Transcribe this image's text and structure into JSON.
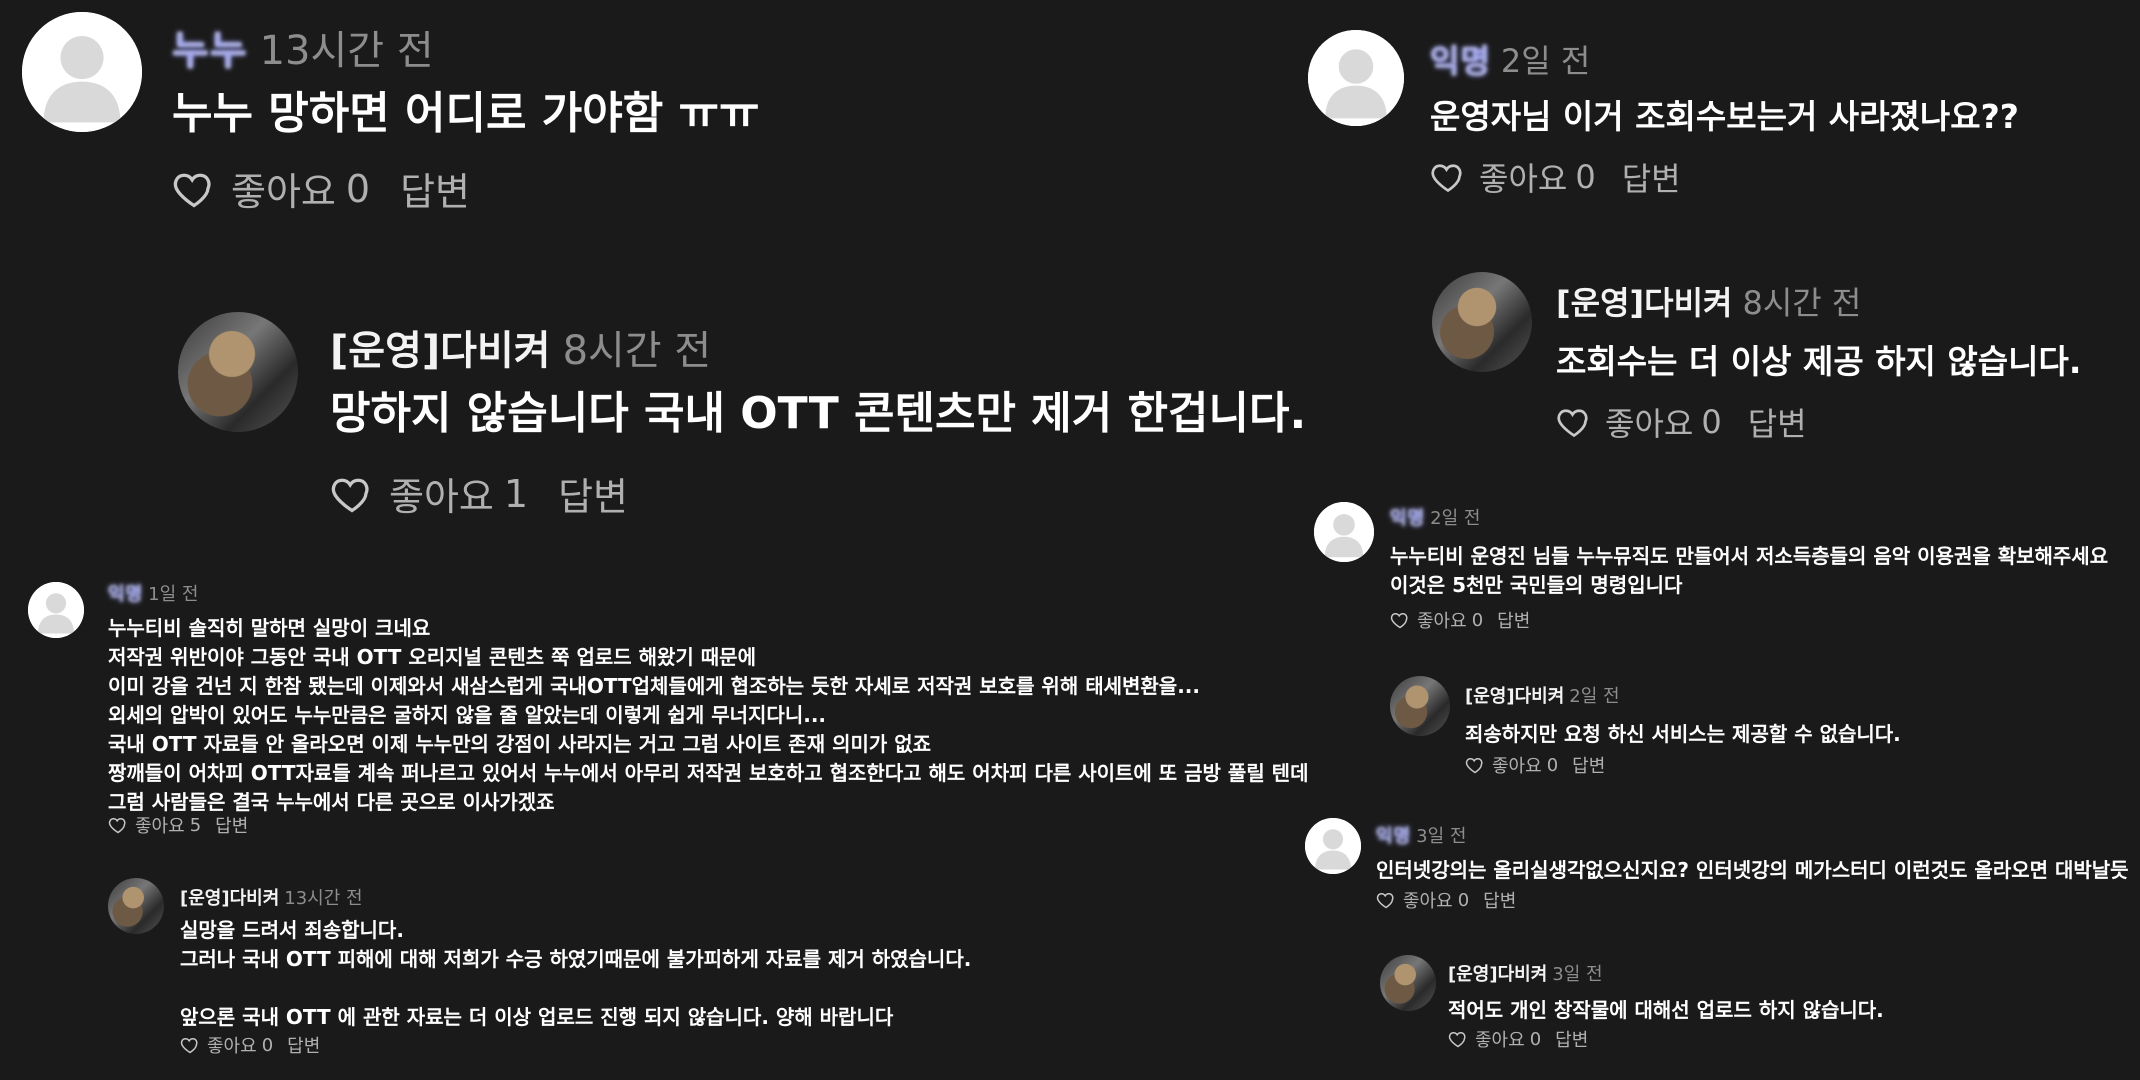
{
  "colors": {
    "background": "#1a1a1a",
    "text": "#ffffff",
    "muted": "#8d8d8d",
    "action": "#b0b0b0"
  },
  "comments": [
    {
      "author": "누누",
      "time": "13시간 전",
      "text": [
        "누누 망하면 어디로 가야함 ㅠㅠ"
      ],
      "like_label": "좋아요",
      "like_count": "0",
      "reply_label": "답변"
    },
    {
      "author": "[운영]다비켜",
      "time": "8시간 전",
      "text": [
        "망하지 않습니다 국내 OTT 콘텐츠만 제거 한겁니다."
      ],
      "like_label": "좋아요",
      "like_count": "1",
      "reply_label": "답변"
    },
    {
      "author": "익명",
      "time": "1일 전",
      "text": [
        "누누티비 솔직히 말하면 실망이 크네요",
        "저작권 위반이야 그동안 국내 OTT 오리지널 콘텐츠 쭉 업로드 해왔기 때문에",
        "이미 강을 건넌 지 한참 됐는데 이제와서 새삼스럽게 국내OTT업체들에게 협조하는 듯한 자세로 저작권 보호를 위해 태세변환을...",
        "외세의 압박이 있어도 누누만큼은 굴하지 않을 줄 알았는데 이렇게 쉽게 무너지다니...",
        "국내 OTT 자료들 안 올라오면 이제 누누만의 강점이 사라지는 거고 그럼 사이트 존재 의미가 없죠",
        "짱깨들이 어차피 OTT자료들 계속 퍼나르고 있어서 누누에서 아무리 저작권 보호하고 협조한다고 해도 어차피 다른 사이트에 또 금방 풀릴 텐데",
        "그럼 사람들은 결국 누누에서 다른 곳으로 이사가겠죠"
      ],
      "like_label": "좋아요",
      "like_count": "5",
      "reply_label": "답변"
    },
    {
      "author": "[운영]다비켜",
      "time": "13시간 전",
      "text": [
        "실망을 드려서 죄송합니다.",
        "그러나 국내 OTT 피해에 대해 저희가 수긍 하였기때문에 불가피하게 자료를 제거 하였습니다.",
        "",
        "앞으론 국내 OTT 에 관한 자료는 더 이상 업로드 진행 되지 않습니다. 양해 바랍니다"
      ],
      "like_label": "좋아요",
      "like_count": "0",
      "reply_label": "답변"
    },
    {
      "author": "익명",
      "time": "2일 전",
      "text": [
        "운영자님 이거 조회수보는거 사라졌나요??"
      ],
      "like_label": "좋아요",
      "like_count": "0",
      "reply_label": "답변"
    },
    {
      "author": "[운영]다비켜",
      "time": "8시간 전",
      "text": [
        "조회수는 더 이상 제공 하지 않습니다."
      ],
      "like_label": "좋아요",
      "like_count": "0",
      "reply_label": "답변"
    },
    {
      "author": "익명",
      "time": "2일 전",
      "text": [
        "누누티비 운영진 님들 누누뮤직도 만들어서 저소득층들의 음악 이용권을 확보해주세요",
        "이것은 5천만 국민들의 명령입니다"
      ],
      "like_label": "좋아요",
      "like_count": "0",
      "reply_label": "답변"
    },
    {
      "author": "[운영]다비켜",
      "time": "2일 전",
      "text": [
        "죄송하지만 요청 하신 서비스는 제공할 수 없습니다."
      ],
      "like_label": "좋아요",
      "like_count": "0",
      "reply_label": "답변"
    },
    {
      "author": "익명",
      "time": "3일 전",
      "text": [
        "인터넷강의는 올리실생각없으신지요? 인터넷강의 메가스터디 이런것도 올라오면 대박날듯"
      ],
      "like_label": "좋아요",
      "like_count": "0",
      "reply_label": "답변"
    },
    {
      "author": "[운영]다비켜",
      "time": "3일 전",
      "text": [
        "적어도 개인 창작물에 대해선 업로드 하지 않습니다."
      ],
      "like_label": "좋아요",
      "like_count": "0",
      "reply_label": "답변"
    }
  ]
}
